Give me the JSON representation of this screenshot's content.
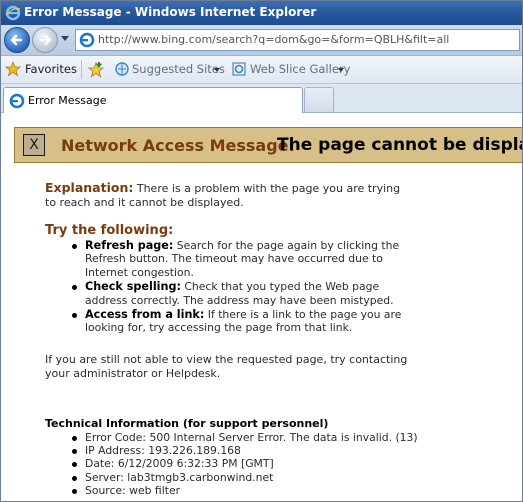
{
  "window": {
    "title": "Error Message - Windows Internet Explorer"
  },
  "navigation": {
    "url": "http://www.bing.com/search?q=dom&go=&form=QBLH&filt=all"
  },
  "favorites_bar": {
    "favorites_label": "Favorites",
    "suggested_sites_label": "Suggested Sites",
    "web_slice_gallery_label": "Web Slice Gallery"
  },
  "tabs": [
    {
      "label": "Error Message"
    }
  ],
  "page": {
    "banner_heading": "Network Access Message:",
    "banner_title": "The page cannot be displayed",
    "explanation_label": "Explanation:",
    "explanation_text": "There is a problem with the page you are trying to reach and it cannot be displayed.",
    "try_heading": "Try the following:",
    "tips": [
      {
        "label": "Refresh page:",
        "text": "Search for the page again by clicking the Refresh button. The timeout may have occurred due to Internet congestion."
      },
      {
        "label": "Check spelling:",
        "text": "Check that you typed the Web page address correctly. The address may have been mistyped."
      },
      {
        "label": "Access from a link:",
        "text": "If there is a link to the page you are looking for, try accessing the page from that link."
      }
    ],
    "still_text": "If you are still not able to view the requested page, try contacting your administrator or Helpdesk.",
    "tech_heading": "Technical Information (for support personnel)",
    "tech_items": [
      "Error Code: 500 Internal Server Error. The data is invalid. (13)",
      "IP Address: 193.226.189.168",
      "Date: 6/12/2009 6:32:33 PM [GMT]",
      "Server: lab3tmgb3.carbonwind.net",
      "Source: web filter"
    ]
  }
}
